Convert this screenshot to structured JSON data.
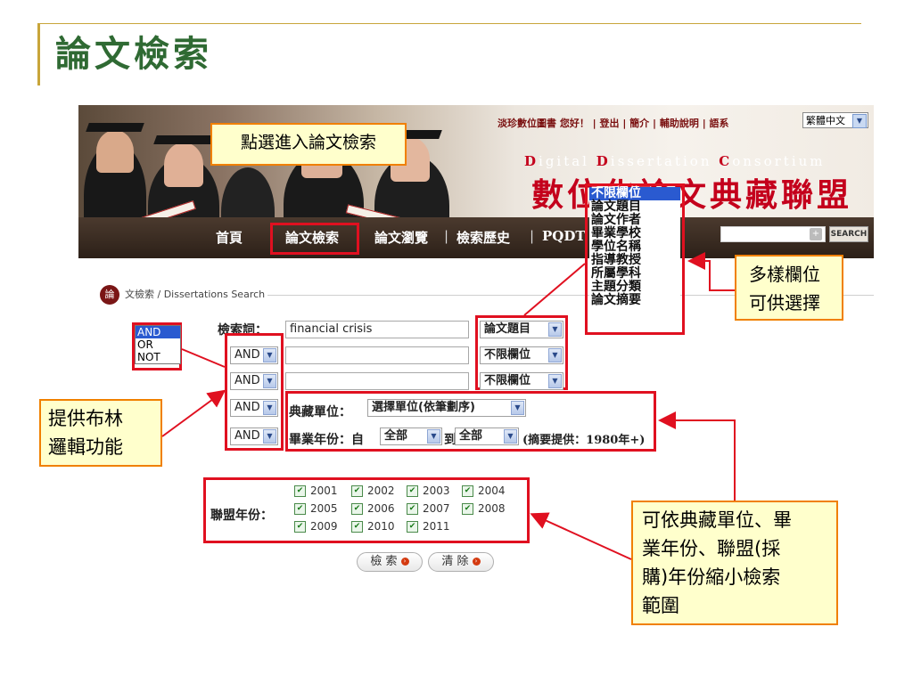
{
  "slide": {
    "title": "論文檢索"
  },
  "banner": {
    "top_links": "淡珍數位圖書 您好！ | 登出 | 簡介 | 輔助說明 | 語系",
    "language": "繁體中文",
    "digital_prefix": "D",
    "digital_text": "igital ",
    "dissertation_prefix": "D",
    "dissertation_text": "issertation ",
    "consortium_prefix": "C",
    "consortium_text": "onsortium",
    "logo_text": "數位化論文典藏聯盟",
    "nav": [
      "首頁",
      "論文檢索",
      "論文瀏覽",
      "檢索歷史",
      "PQDT"
    ],
    "search_button": "SEARCH",
    "search_plus": "+"
  },
  "form": {
    "breadcrumb_icon": "論",
    "breadcrumb": "文檢索 / Dissertations Search",
    "keyword_label": "檢索詞：",
    "keyword_value": "financial crisis",
    "field1": "論文題目",
    "field2": "不限欄位",
    "field3": "不限欄位",
    "boolean": [
      "AND",
      "AND",
      "AND",
      "AND"
    ],
    "boolean_options": [
      "AND",
      "OR",
      "NOT"
    ],
    "institution_label": "典藏單位：",
    "institution_value": "選擇單位(依筆劃序)",
    "grad_label": "畢業年份：自",
    "grad_from": "全部",
    "grad_to_label": "到",
    "grad_to": "全部",
    "grad_note": "(摘要提供：1980年+)",
    "consortium_label": "聯盟年份：",
    "years": [
      "2001",
      "2002",
      "2003",
      "2004",
      "2005",
      "2006",
      "2007",
      "2008",
      "2009",
      "2010",
      "2011"
    ],
    "search_btn": "檢 索",
    "clear_btn": "清 除",
    "field_options": [
      "不限欄位",
      "論文題目",
      "論文作者",
      "畢業學校",
      "學位名稱",
      "指導教授",
      "所屬學科",
      "主題分類",
      "論文摘要"
    ]
  },
  "annotations": {
    "entry": "點選進入論文檢索",
    "fields_line1": "多樣欄位",
    "fields_line2": "可供選擇",
    "boolean_line1": "提供布林",
    "boolean_line2": "邏輯功能",
    "narrow_line1": "可依典藏單位、畢",
    "narrow_line2": "業年份、聯盟(採",
    "narrow_line3": "購)年份縮小檢索",
    "narrow_line4": "範圍"
  },
  "colors": {
    "title_green": "#2f6a33",
    "annot_border": "#f08000",
    "annot_fill": "#ffffcc",
    "highlight_red": "#e01020",
    "logo_red": "#c4001c"
  }
}
